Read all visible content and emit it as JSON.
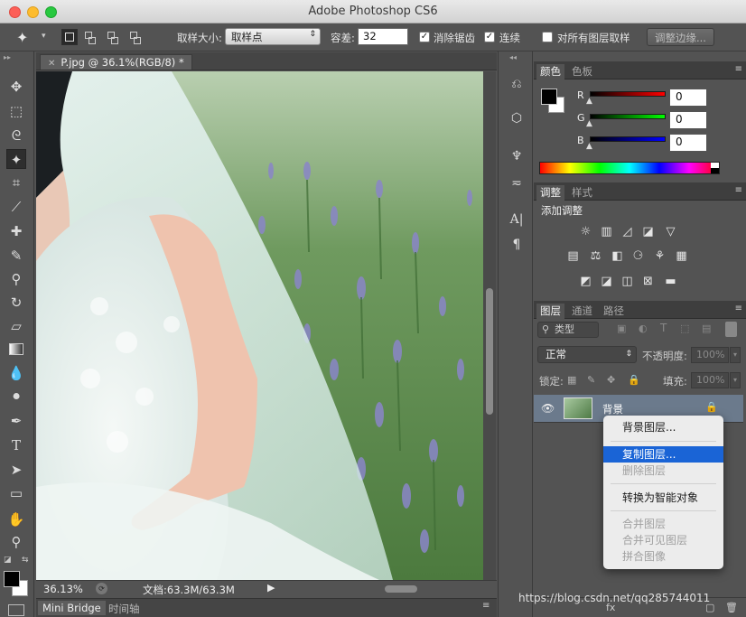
{
  "window": {
    "title": "Adobe Photoshop CS6"
  },
  "options": {
    "sample_size_label": "取样大小:",
    "sample_size_value": "取样点",
    "tolerance_label": "容差:",
    "tolerance_value": "32",
    "antialias_label": "消除锯齿",
    "contiguous_label": "连续",
    "all_layers_label": "对所有图层取样",
    "refine_edge_label": "调整边缘..."
  },
  "document": {
    "tab_title": "P.jpg @ 36.1%(RGB/8) *",
    "zoom": "36.13%",
    "doc_size": "文档:63.3M/63.3M"
  },
  "bottom_tabs": [
    "Mini Bridge",
    "时间轴"
  ],
  "color_panel": {
    "tabs": [
      "颜色",
      "色板"
    ],
    "channels": [
      {
        "label": "R",
        "value": "0"
      },
      {
        "label": "G",
        "value": "0"
      },
      {
        "label": "B",
        "value": "0"
      }
    ]
  },
  "adjust_panel": {
    "tabs": [
      "调整",
      "样式"
    ],
    "heading": "添加调整"
  },
  "layers_panel": {
    "tabs": [
      "图层",
      "通道",
      "路径"
    ],
    "filter_label": "类型",
    "blend_mode": "正常",
    "opacity_label": "不透明度:",
    "opacity_value": "100%",
    "lock_label": "锁定:",
    "fill_label": "填充:",
    "fill_value": "100%",
    "layer_name": "背景"
  },
  "context_menu": {
    "items": [
      {
        "label": "背景图层...",
        "state": "normal"
      },
      {
        "label": "复制图层...",
        "state": "selected"
      },
      {
        "label": "删除图层",
        "state": "disabled"
      },
      {
        "label": "转换为智能对象",
        "state": "normal"
      },
      {
        "label": "合并图层",
        "state": "disabled"
      },
      {
        "label": "合并可见图层",
        "state": "disabled"
      },
      {
        "label": "拼合图像",
        "state": "disabled"
      }
    ]
  },
  "watermark": "https://blog.csdn.net/qq285744011",
  "colors": {
    "selection": "#1a64d6",
    "panel_bg": "#535353"
  }
}
